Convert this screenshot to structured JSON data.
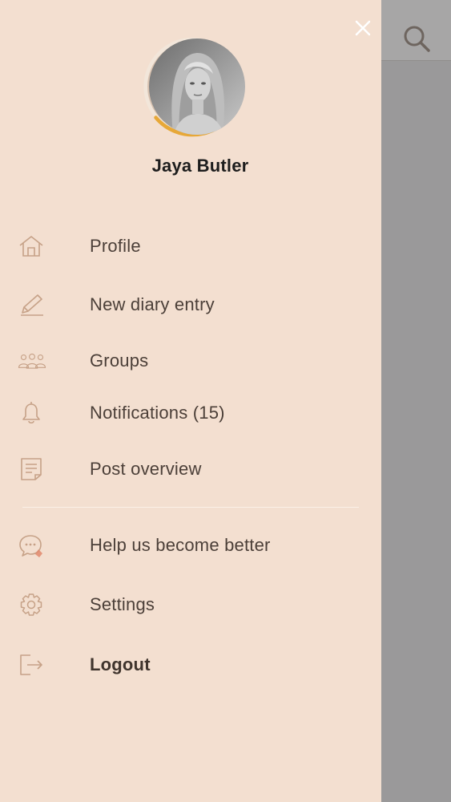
{
  "user": {
    "name": "Jaya Butler"
  },
  "menu": {
    "primary": [
      {
        "label": "Profile",
        "icon": "home-icon"
      },
      {
        "label": "New diary entry",
        "icon": "pencil-icon"
      },
      {
        "label": "Groups",
        "icon": "group-icon"
      },
      {
        "label": "Notifications (15)",
        "icon": "bell-icon"
      },
      {
        "label": "Post overview",
        "icon": "document-icon"
      }
    ],
    "secondary": [
      {
        "label": "Help us become better",
        "icon": "feedback-chat-icon"
      },
      {
        "label": "Settings",
        "icon": "gear-icon"
      },
      {
        "label": "Logout",
        "icon": "logout-icon"
      }
    ]
  },
  "colors": {
    "drawer_bg": "#f3dfd0",
    "scrim": "#9a999a",
    "accent": "#e7a838",
    "icon_stroke": "#c6a187",
    "text": "#4b3f38"
  }
}
